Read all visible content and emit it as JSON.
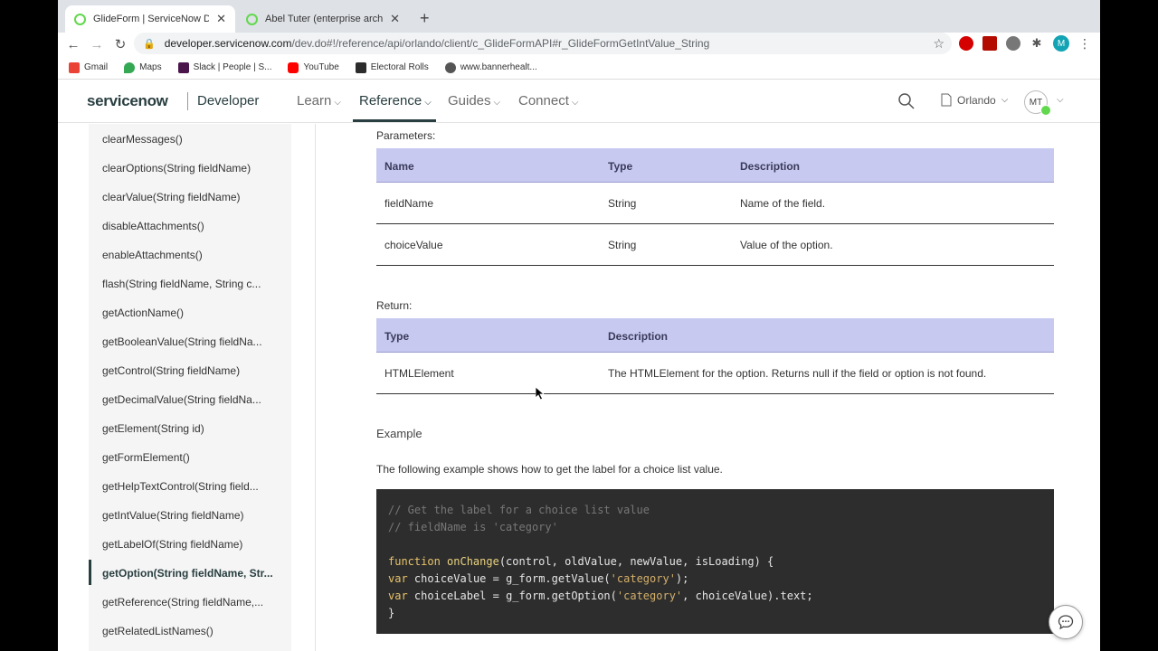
{
  "browser": {
    "tabs": [
      {
        "title": "GlideForm | ServiceNow Devel",
        "active": true
      },
      {
        "title": "Abel Tuter (enterprise architect)",
        "active": false
      }
    ],
    "new_tab": "+",
    "close": "✕",
    "url_host": "developer.servicenow.com",
    "url_rest": "/dev.do#!/reference/api/orlando/client/c_GlideFormAPI#r_GlideFormGetIntValue_String",
    "profile_initial": "M",
    "bookmarks": [
      "Gmail",
      "Maps",
      "Slack | People | S...",
      "YouTube",
      "Electoral Rolls",
      "www.bannerhealt..."
    ]
  },
  "header": {
    "logo": "servicenow",
    "developer": "Developer",
    "nav": [
      {
        "label": "Learn"
      },
      {
        "label": "Reference"
      },
      {
        "label": "Guides"
      },
      {
        "label": "Connect"
      }
    ],
    "release": "Orlando",
    "avatar_initials": "MT"
  },
  "sidebar": {
    "items": [
      "clearMessages()",
      "clearOptions(String fieldName)",
      "clearValue(String fieldName)",
      "disableAttachments()",
      "enableAttachments()",
      "flash(String fieldName, String c...",
      "getActionName()",
      "getBooleanValue(String fieldNa...",
      "getControl(String fieldName)",
      "getDecimalValue(String fieldNa...",
      "getElement(String id)",
      "getFormElement()",
      "getHelpTextControl(String field...",
      "getIntValue(String fieldName)",
      "getLabelOf(String fieldName)",
      "getOption(String fieldName, Str...",
      "getReference(String fieldName,...",
      "getRelatedListNames()"
    ],
    "active_index": 15
  },
  "content": {
    "parameters_label": "Parameters:",
    "parameters": {
      "headers": [
        "Name",
        "Type",
        "Description"
      ],
      "rows": [
        [
          "fieldName",
          "String",
          "Name of the field."
        ],
        [
          "choiceValue",
          "String",
          "Value of the option."
        ]
      ]
    },
    "return_label": "Return:",
    "returns": {
      "headers": [
        "Type",
        "Description"
      ],
      "rows": [
        [
          "HTMLElement",
          "The HTMLElement for the option. Returns null if the field or option is not found."
        ]
      ]
    },
    "example_title": "Example",
    "example_desc": "The following example shows how to get the label for a choice list value.",
    "code": {
      "line1": "// Get the label for a choice list value",
      "line2": "// fieldName is 'category'",
      "kw_function": "function",
      "fn_name": "onChange",
      "fn_args": "(control, oldValue, newValue, isLoading) {",
      "kw_var": "var",
      "var1": "choiceValue = g_form.getValue(",
      "str_category": "'category'",
      "var1_end": ");",
      "var2": "choiceLabel = g_form.getOption(",
      "var2_end": ", choiceValue).text;",
      "close": "}"
    }
  }
}
